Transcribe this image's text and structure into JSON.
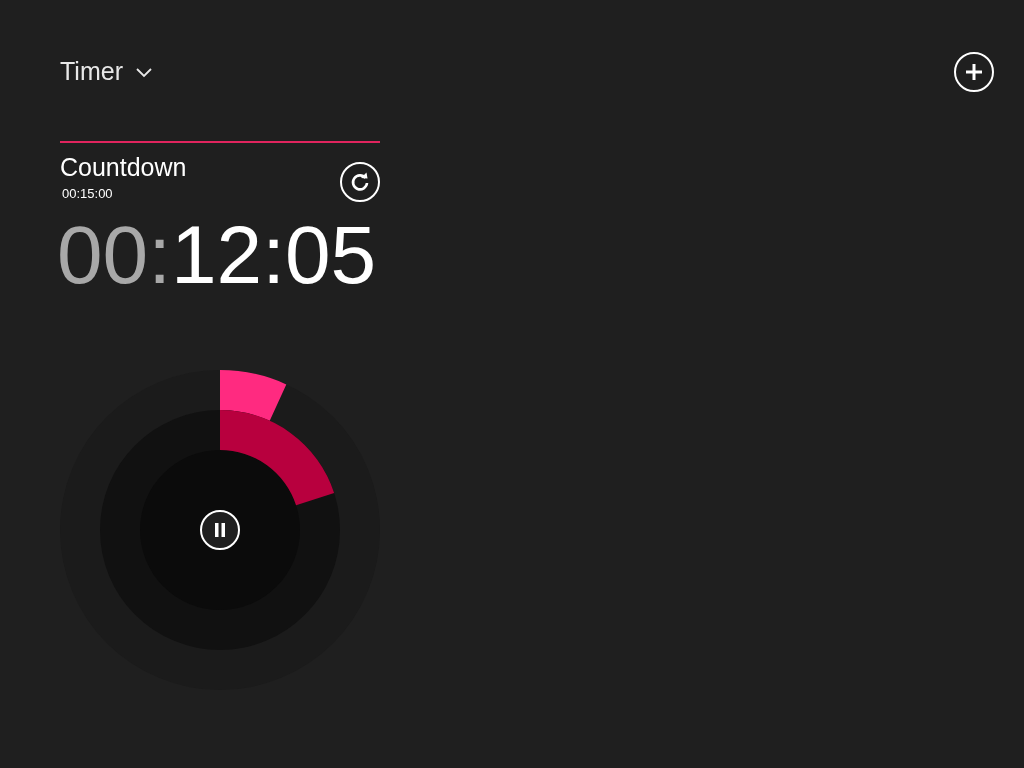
{
  "header": {
    "title": "Timer"
  },
  "timer": {
    "name": "Countdown",
    "duration": "00:15:00",
    "time_parts": [
      {
        "text": "00",
        "dimmed": true
      },
      {
        "text": ":",
        "dimmed": true
      },
      {
        "text": "12:05",
        "dimmed": false
      }
    ],
    "rings": [
      {
        "kind": "outer",
        "color": "#ff2a80"
      },
      {
        "kind": "middle",
        "color": "#b8003e"
      }
    ]
  }
}
